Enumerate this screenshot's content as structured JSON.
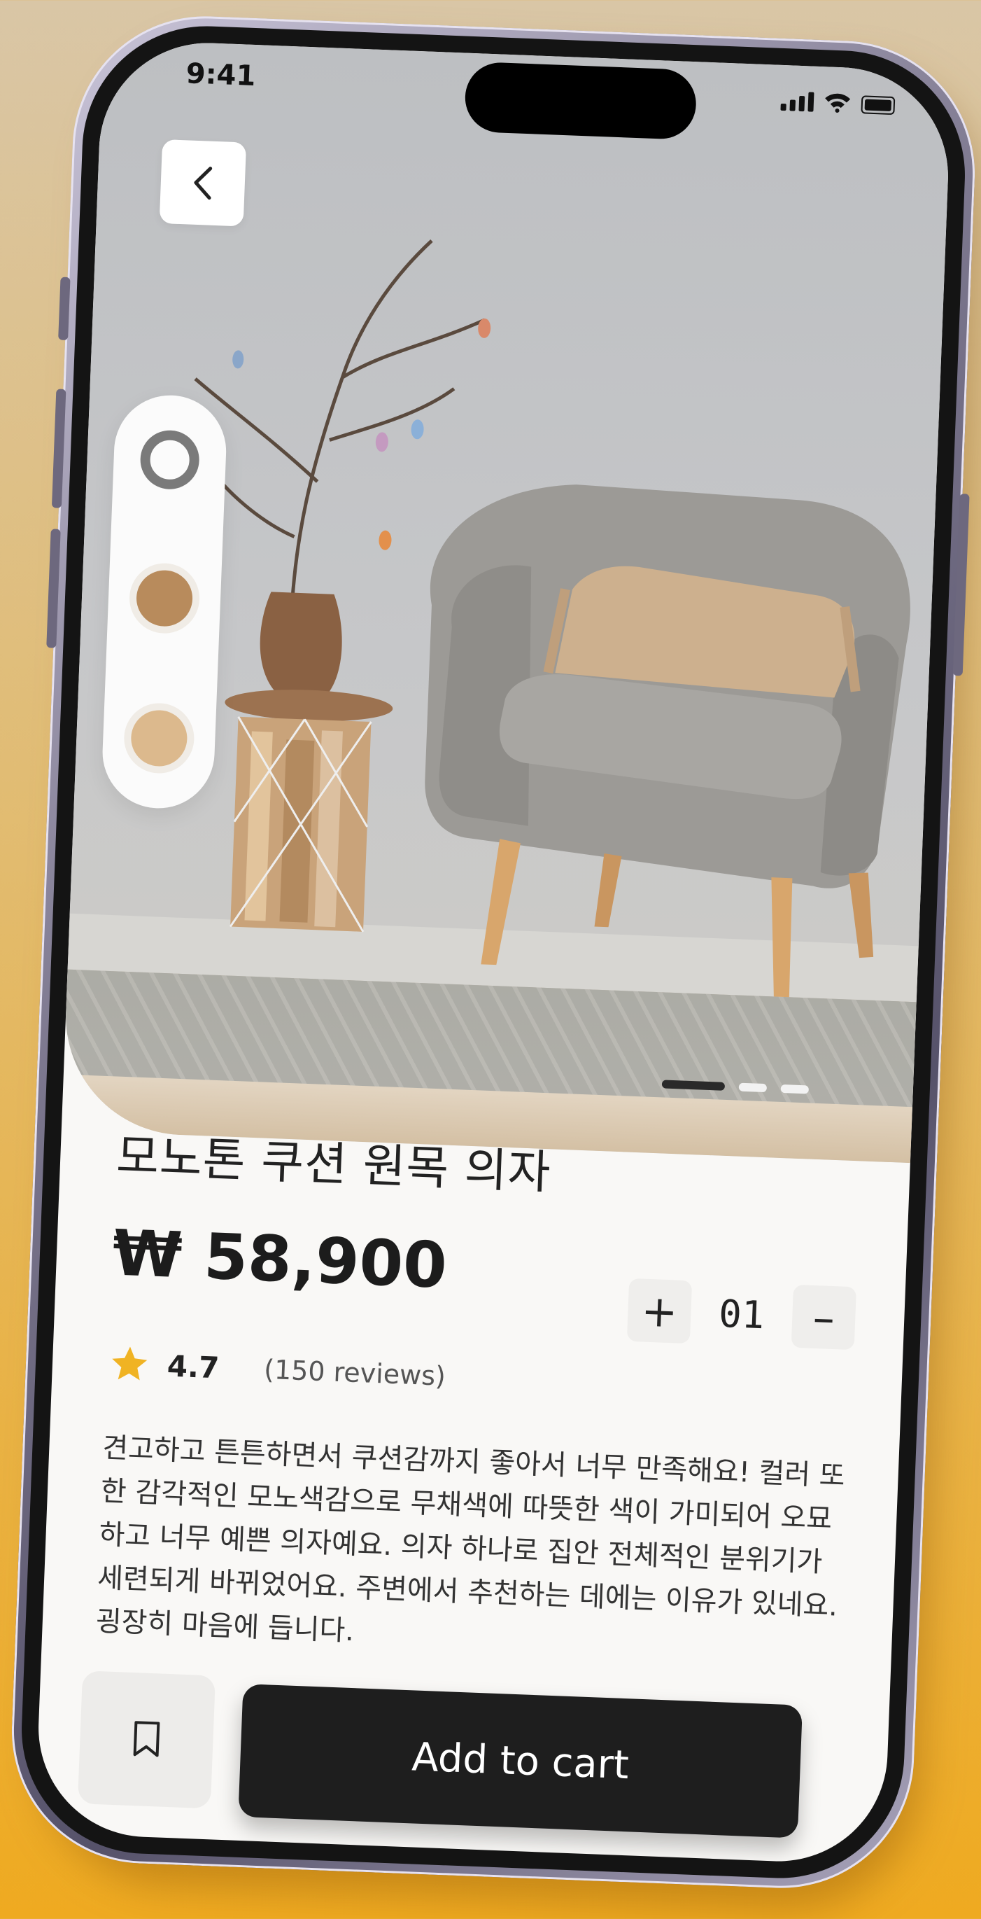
{
  "status_bar": {
    "time": "9:41"
  },
  "product": {
    "title": "모노톤 쿠션 원목 의자",
    "price": "₩ 58,900",
    "rating": "4.7",
    "reviews": "(150 reviews)",
    "description": "견고하고 튼튼하면서 쿠션감까지 좋아서 너무 만족해요! 컬러 또한 감각적인 모노색감으로 무채색에 따뜻한 색이 가미되어 오묘하고 너무 예쁜 의자예요. 의자 하나로 집안 전체적인 분위기가 세련되게 바뀌었어요. 주변에서 추천하는 데에는 이유가 있네요. 굉장히 마음에 듭니다."
  },
  "quantity": {
    "plus_label": "+",
    "value": "01",
    "minus_label": "–"
  },
  "actions": {
    "add_to_cart_label": "Add to cart"
  },
  "swatches": [
    {
      "name": "gray",
      "color": "#7a7a7a",
      "selected": true
    },
    {
      "name": "brown",
      "color": "#b88b5c",
      "selected": false
    },
    {
      "name": "beige",
      "color": "#dcb98d",
      "selected": false
    }
  ],
  "carousel": {
    "count": 3,
    "active_index": 0
  },
  "colors": {
    "accent": "#1e1e1e",
    "star": "#f0b323",
    "background": "#f9f8f6"
  },
  "icons": {
    "back": "chevron-left-icon",
    "bookmark": "bookmark-icon",
    "star": "star-icon",
    "signal": "signal-icon",
    "wifi": "wifi-icon",
    "battery": "battery-icon"
  }
}
